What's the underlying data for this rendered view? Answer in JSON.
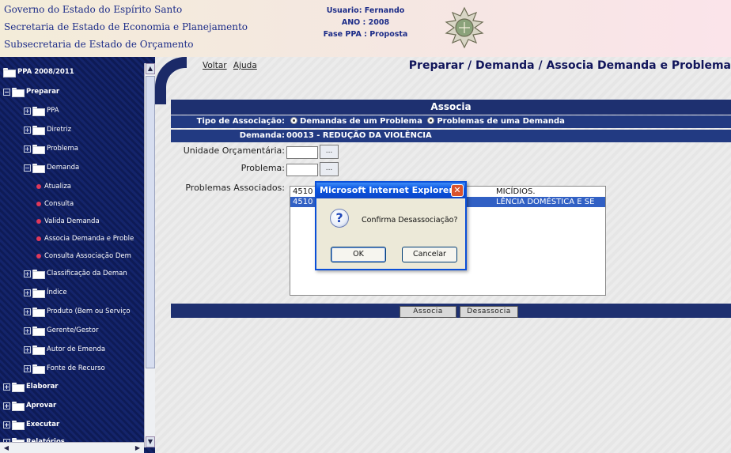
{
  "header": {
    "line1": "Governo do Estado do Espírito Santo",
    "line2": "Secretaria de Estado de Economia e Planejamento",
    "line3": "Subsecretaria de Estado de Orçamento",
    "user": "Usuario: Fernando",
    "year": "ANO : 2008",
    "phase": "Fase PPA : Proposta",
    "crest_icon": "coat-of-arms-icon"
  },
  "sidebar": {
    "root": "PPA 2008/2011",
    "preparar": "Preparar",
    "items": {
      "ppa": "PPA",
      "diretriz": "Diretriz",
      "problema": "Problema",
      "demanda": "Demanda",
      "atualiza": "Atualiza",
      "consulta": "Consulta",
      "valida": "Valida Demanda",
      "associa": "Associa Demanda e Proble",
      "consulta_assoc": "Consulta Associação Dem",
      "classificacao": "Classificação da Deman",
      "indice": "Índice",
      "produto": "Produto (Bem ou Serviço",
      "gerente": "Gerente/Gestor",
      "autor": "Autor de Emenda",
      "fonte": "Fonte de Recurso"
    },
    "elaborar": "Elaborar",
    "aprovar": "Aprovar",
    "executar": "Executar",
    "relatorios": "Relatórios"
  },
  "main": {
    "voltar": "Voltar",
    "ajuda": "Ajuda",
    "breadcrumb": "Preparar / Demanda / Associa Demanda e Problema",
    "panel_title": "Associa",
    "tipo_label": "Tipo de Associação:",
    "tipo_opt1": "Demandas de um Problema",
    "tipo_opt2": "Problemas de uma Demanda",
    "demanda_label": "Demanda:",
    "demanda_value": "00013 - REDUÇÃO DA VIOLÊNCIA",
    "unidade_label": "Unidade Orçamentária:",
    "problema_label": "Problema:",
    "lookup_label": "...",
    "associados_label": "Problemas Associados:",
    "list": [
      {
        "code": "4510",
        "rest": "MICÍDIOS."
      },
      {
        "code": "4510",
        "rest": "LÊNCIA DOMÉSTICA E SE"
      }
    ],
    "btn_associa": "Associa",
    "btn_desassocia": "Desassocia"
  },
  "dialog": {
    "title": "Microsoft Internet Explorer",
    "message": "Confirma Desassociação?",
    "ok": "OK",
    "cancel": "Cancelar",
    "close": "✕",
    "icon": "question-icon"
  },
  "colors": {
    "sidebar_bg": "#14246b",
    "panel_bar": "#1e3070",
    "header_text": "#1c2c88",
    "selection": "#3160c4"
  }
}
